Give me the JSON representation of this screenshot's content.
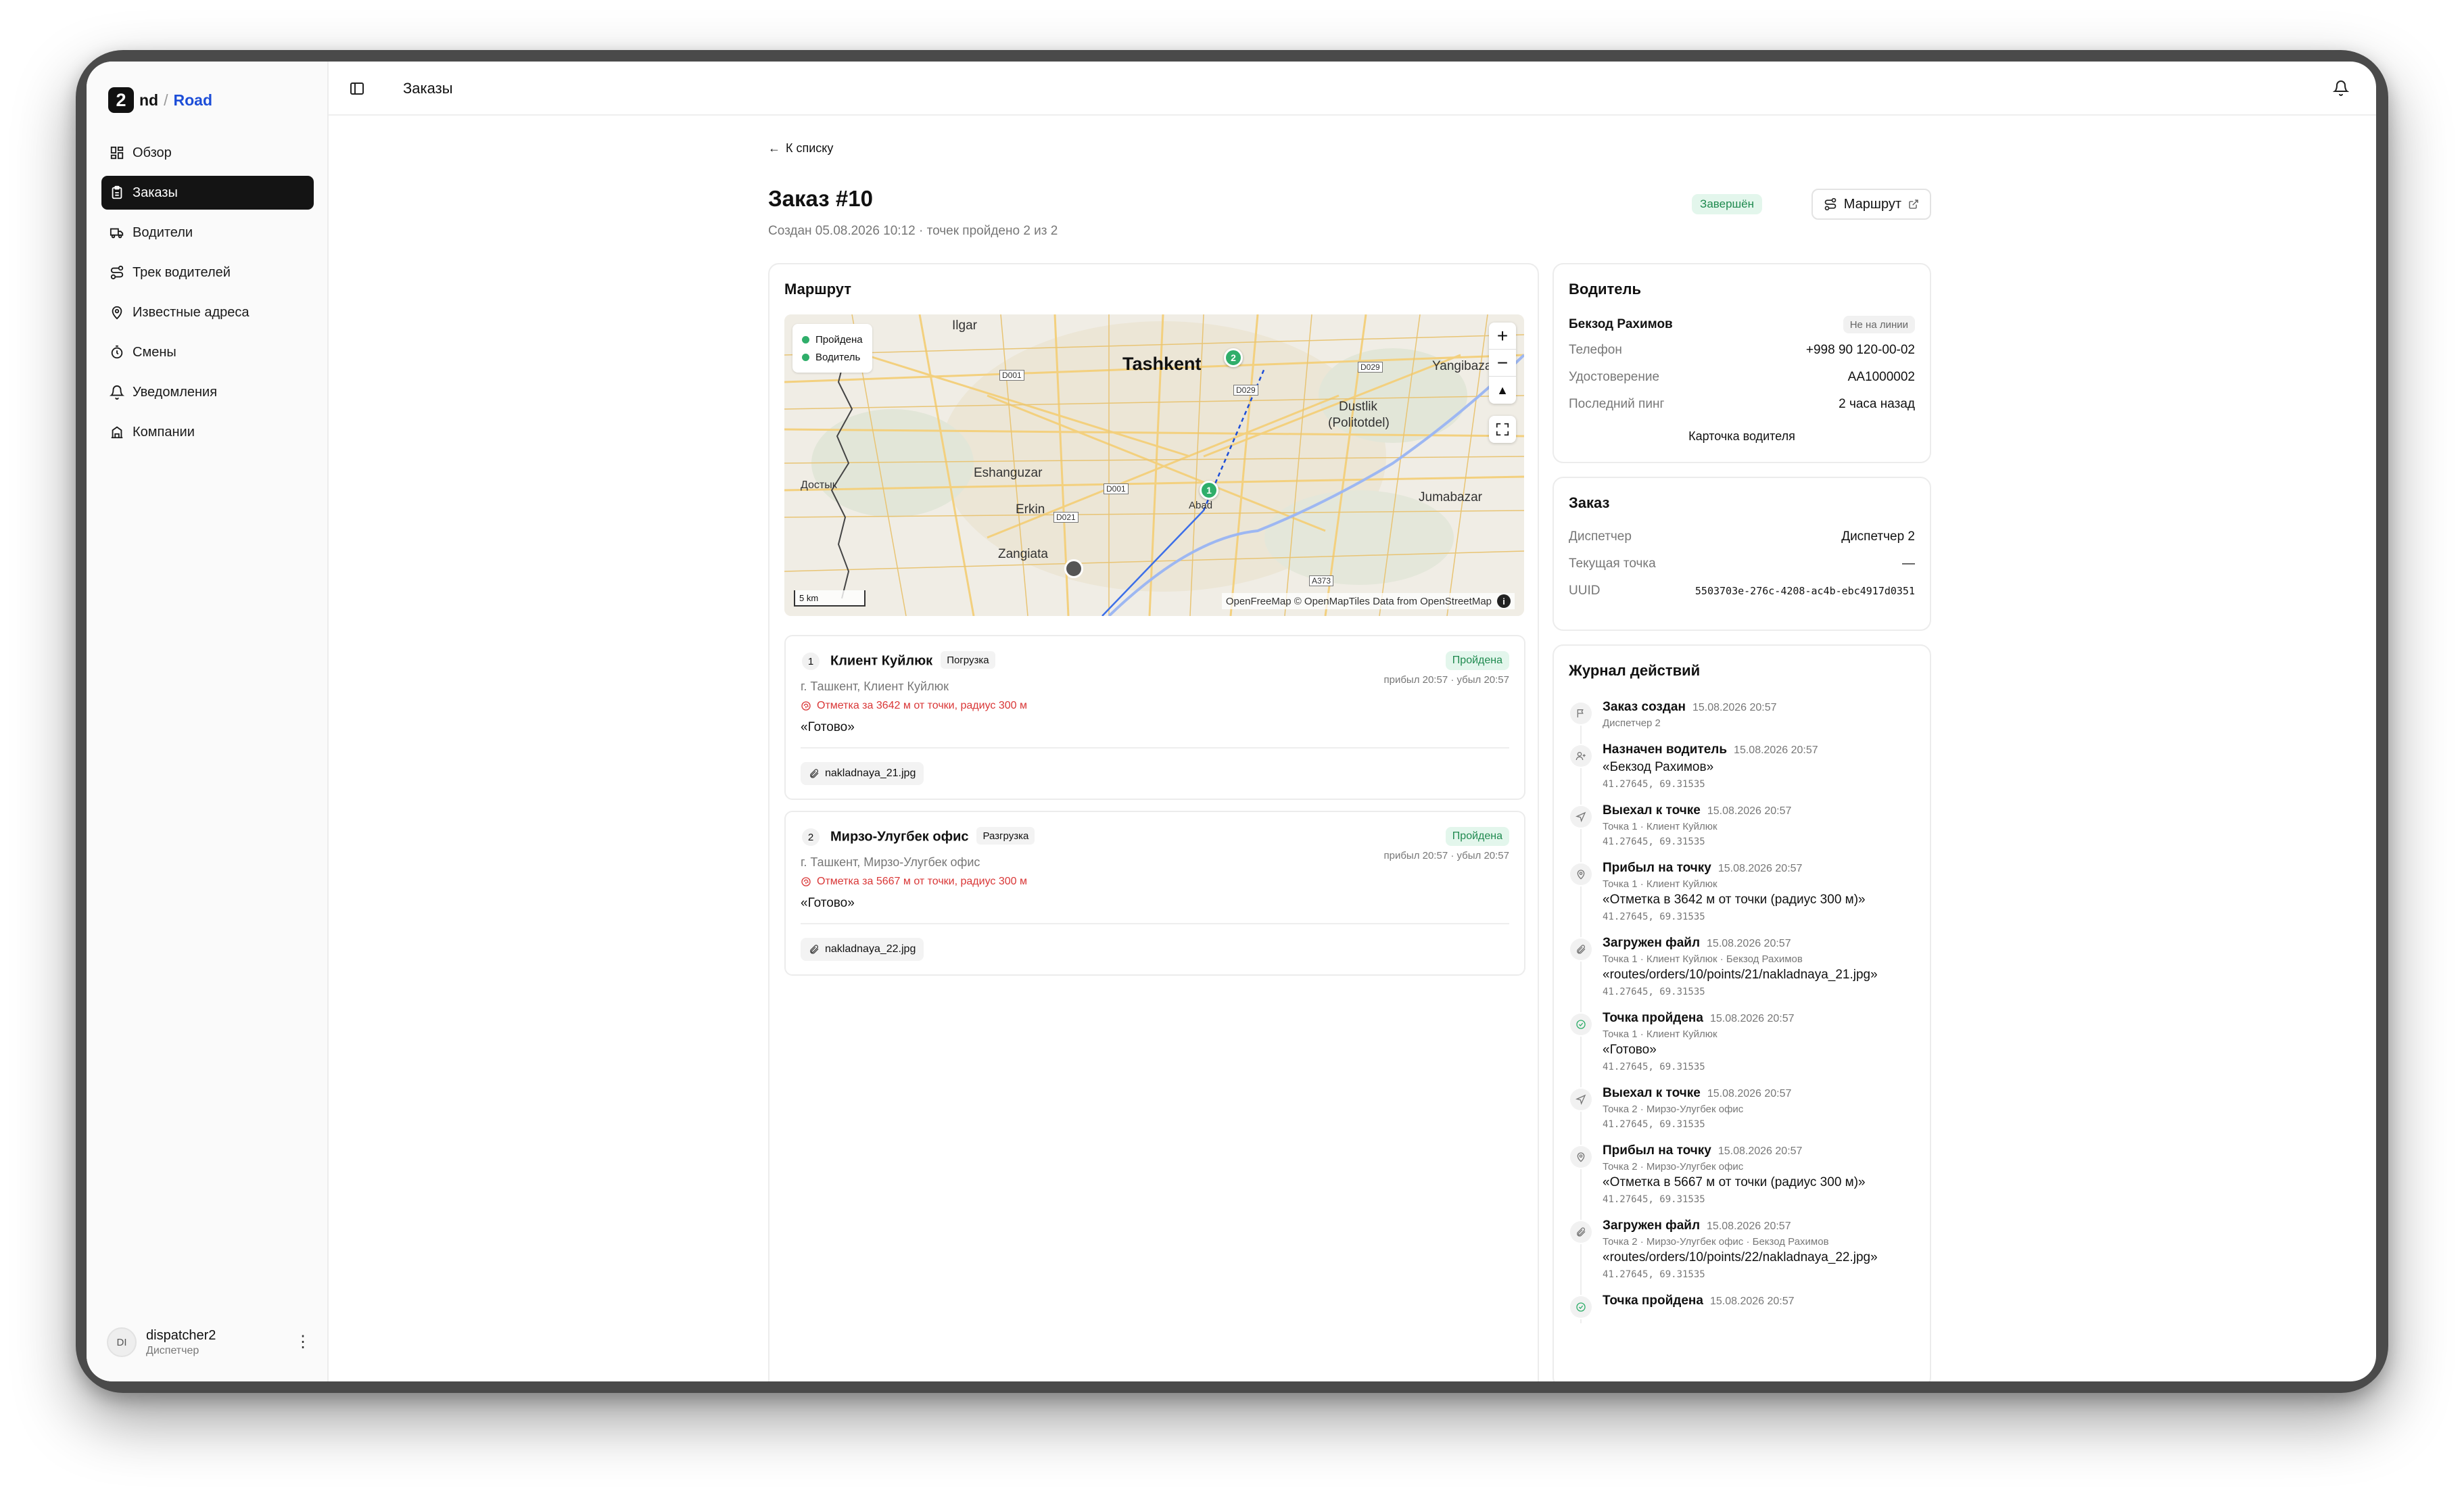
{
  "app": {
    "logo_mark": "2",
    "logo_nd": "nd",
    "logo_slash": "/",
    "logo_road": "Road"
  },
  "nav": [
    {
      "label": "Обзор",
      "icon": "dashboard-icon"
    },
    {
      "label": "Заказы",
      "icon": "clipboard-icon",
      "active": true
    },
    {
      "label": "Водители",
      "icon": "truck-icon"
    },
    {
      "label": "Трек водителей",
      "icon": "route-icon"
    },
    {
      "label": "Известные адреса",
      "icon": "map-pin-icon"
    },
    {
      "label": "Смены",
      "icon": "timer-icon"
    },
    {
      "label": "Уведомления",
      "icon": "bell-icon"
    },
    {
      "label": "Компании",
      "icon": "building-icon"
    }
  ],
  "user": {
    "initials": "DI",
    "name": "dispatcher2",
    "role": "Диспетчер"
  },
  "topbar": {
    "title": "Заказы"
  },
  "page": {
    "back": "К списку",
    "title": "Заказ #10",
    "subtitle": "Создан 05.08.2026 10:12 · точек пройдено 2 из 2",
    "status": "Завершён",
    "route_button": "Маршрут"
  },
  "route": {
    "title": "Маршрут",
    "legend": [
      "Пройдена",
      "Водитель"
    ],
    "map_labels": {
      "city": "Tashkent",
      "places": [
        "Ilgar",
        "Eshanguzar",
        "Erkin",
        "Zangiata",
        "Dustlik",
        "(Politotdel)",
        "Jumabazar",
        "Yangibaza",
        "Достык",
        "Abad"
      ],
      "roads": [
        "D001",
        "D029",
        "D029",
        "D001",
        "D021",
        "A373"
      ]
    },
    "scale": "5 km",
    "attribution": "OpenFreeMap © OpenMapTiles Data from OpenStreetMap",
    "points": [
      {
        "num": "1",
        "name": "Клиент Куйлюк",
        "type": "Погрузка",
        "status": "Пройдена",
        "times": "прибыл 20:57 · убыл 20:57",
        "address": "г. Ташкент, Клиент Куйлюк",
        "warning": "Отметка за 3642 м от точки, радиус 300 м",
        "comment": "«Готово»",
        "file": "nakladnaya_21.jpg"
      },
      {
        "num": "2",
        "name": "Мирзо-Улугбек офис",
        "type": "Разгрузка",
        "status": "Пройдена",
        "times": "прибыл 20:57 · убыл 20:57",
        "address": "г. Ташкент, Мирзо-Улугбек офис",
        "warning": "Отметка за 5667 м от точки, радиус 300 м",
        "comment": "«Готово»",
        "file": "nakladnaya_22.jpg"
      }
    ]
  },
  "driver": {
    "title": "Водитель",
    "name": "Бекзод Рахимов",
    "status": "Не на линии",
    "phone_label": "Телефон",
    "phone": "+998 90 120-00-02",
    "license_label": "Удостоверение",
    "license": "AA1000002",
    "ping_label": "Последний пинг",
    "ping": "2 часа назад",
    "card_link": "Карточка водителя"
  },
  "order": {
    "title": "Заказ",
    "dispatcher_label": "Диспетчер",
    "dispatcher": "Диспетчер 2",
    "point_label": "Текущая точка",
    "point": "—",
    "uuid_label": "UUID",
    "uuid": "5503703e-276c-4208-ac4b-ebc4917d0351"
  },
  "log": {
    "title": "Журнал действий",
    "entries": [
      {
        "icon": "flag-icon",
        "title": "Заказ создан",
        "time": "15.08.2026 20:57",
        "sub": "Диспетчер 2",
        "text": "",
        "coord": ""
      },
      {
        "icon": "user-plus-icon",
        "title": "Назначен водитель",
        "time": "15.08.2026 20:57",
        "sub": "",
        "text": "«Бекзод Рахимов»",
        "coord": "41.27645, 69.31535"
      },
      {
        "icon": "navigation-icon",
        "title": "Выехал к точке",
        "time": "15.08.2026 20:57",
        "sub": "Точка 1 · Клиент Куйлюк",
        "text": "",
        "coord": "41.27645, 69.31535"
      },
      {
        "icon": "map-pin-icon",
        "title": "Прибыл на точку",
        "time": "15.08.2026 20:57",
        "sub": "Точка 1 · Клиент Куйлюк",
        "text": "«Отметка в 3642 м от точки (радиус 300 м)»",
        "coord": "41.27645, 69.31535"
      },
      {
        "icon": "paperclip-icon",
        "title": "Загружен файл",
        "time": "15.08.2026 20:57",
        "sub": "Точка 1 · Клиент Куйлюк · Бекзод Рахимов",
        "text": "«routes/orders/10/points/21/nakladnaya_21.jpg»",
        "coord": "41.27645, 69.31535"
      },
      {
        "icon": "check-circle-icon",
        "title": "Точка пройдена",
        "time": "15.08.2026 20:57",
        "sub": "Точка 1 · Клиент Куйлюк",
        "text": "«Готово»",
        "coord": "41.27645, 69.31535"
      },
      {
        "icon": "navigation-icon",
        "title": "Выехал к точке",
        "time": "15.08.2026 20:57",
        "sub": "Точка 2 · Мирзо-Улугбек офис",
        "text": "",
        "coord": "41.27645, 69.31535"
      },
      {
        "icon": "map-pin-icon",
        "title": "Прибыл на точку",
        "time": "15.08.2026 20:57",
        "sub": "Точка 2 · Мирзо-Улугбек офис",
        "text": "«Отметка в 5667 м от точки (радиус 300 м)»",
        "coord": "41.27645, 69.31535"
      },
      {
        "icon": "paperclip-icon",
        "title": "Загружен файл",
        "time": "15.08.2026 20:57",
        "sub": "Точка 2 · Мирзо-Улугбек офис · Бекзод Рахимов",
        "text": "«routes/orders/10/points/22/nakladnaya_22.jpg»",
        "coord": "41.27645, 69.31535"
      },
      {
        "icon": "check-circle-icon",
        "title": "Точка пройдена",
        "time": "15.08.2026 20:57",
        "sub": "",
        "text": "",
        "coord": ""
      }
    ]
  },
  "colors": {
    "accent": "#1d4ed8",
    "success": "#2fae6a",
    "danger": "#d93636"
  }
}
